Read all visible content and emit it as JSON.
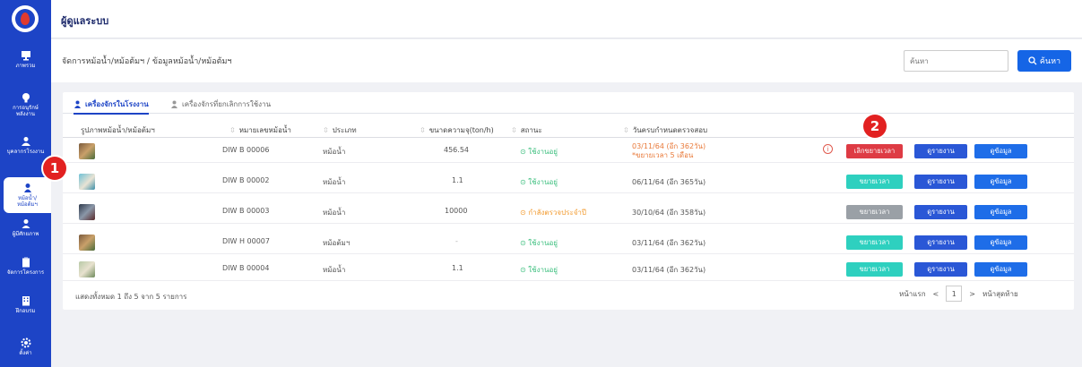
{
  "sidebar": {
    "items": [
      {
        "label": "ภาพรวม",
        "icon": "monitor-icon"
      },
      {
        "label": "การอนุรักษ์ พลังงาน",
        "icon": "bulb-icon"
      },
      {
        "label": "บุคลากรโรงงาน",
        "icon": "people-icon"
      },
      {
        "label": "หม้อน้ำ/ หม้อต้มฯ",
        "icon": "boiler-icon"
      },
      {
        "label": "ผู้มีศักยภาพ",
        "icon": "person-icon"
      },
      {
        "label": "จัดการโครงการ",
        "icon": "clipboard-icon"
      },
      {
        "label": "ฝึกอบรม",
        "icon": "building-icon"
      },
      {
        "label": "ตั้งค่า",
        "icon": "gear-icon"
      }
    ]
  },
  "header": {
    "title": "ผู้ดูแลระบบ"
  },
  "breadcrumb": "จัดการหม้อน้ำ/หม้อต้มฯ / ข้อมูลหม้อน้ำ/หม้อต้มฯ",
  "search": {
    "placeholder": "ค้นหา",
    "button_label": "ค้นหา"
  },
  "tabs": [
    {
      "label": "เครื่องจักรในโรงงาน",
      "active": true
    },
    {
      "label": "เครื่องจักรที่ยกเลิกการใช้งาน",
      "active": false
    }
  ],
  "table": {
    "columns": [
      "รูปภาพหม้อน้ำ/หม้อต้มฯ",
      "หมายเลขหม้อน้ำ",
      "ประเภท",
      "ขนาดความจุ(ton/h)",
      "สถานะ",
      "วันครบกำหนดตรวจสอบ"
    ],
    "rows": [
      {
        "id": "DIW B 00006",
        "type": "หม้อน้ำ",
        "capacity": "456.54",
        "status": "ใช้งานอยู่",
        "due": "03/11/64 (อีก 362วัน)",
        "due_note": "*ขยายเวลา 5 เดือน",
        "action": "เลิกขยายเวลา"
      },
      {
        "id": "DIW B 00002",
        "type": "หม้อน้ำ",
        "capacity": "1.1",
        "status": "ใช้งานอยู่",
        "due": "06/11/64 (อีก 365วัน)",
        "due_note": "",
        "action": "ขยายเวลา"
      },
      {
        "id": "DIW B 00003",
        "type": "หม้อน้ำ",
        "capacity": "10000",
        "status": "กำลังตรวจประจำปี",
        "due": "30/10/64 (อีก 358วัน)",
        "due_note": "",
        "action": "ขยายเวลา"
      },
      {
        "id": "DIW H 00007",
        "type": "หม้อต้มฯ",
        "capacity": "-",
        "status": "ใช้งานอยู่",
        "due": "03/11/64 (อีก 362วัน)",
        "due_note": "",
        "action": "ขยายเวลา"
      },
      {
        "id": "DIW B 00004",
        "type": "หม้อน้ำ",
        "capacity": "1.1",
        "status": "ใช้งานอยู่",
        "due": "03/11/64 (อีก 362วัน)",
        "due_note": "",
        "action": "ขยายเวลา"
      }
    ],
    "report_label": "ดูรายงาน",
    "info_label": "ดูข้อมูล"
  },
  "footer": {
    "summary": "แสดงทั้งหมด 1 ถึง 5 จาก 5 รายการ",
    "first": "หน้าแรก",
    "prev": "<",
    "page": "1",
    "next": ">",
    "last": "หน้าสุดท้าย"
  },
  "markers": [
    "1",
    "2"
  ],
  "colors": {
    "sidebar": "#1d44c6",
    "primary": "#1565e6",
    "teal": "#2ed0bf",
    "danger": "#de3b44",
    "ok": "#3cbf7e",
    "warn": "#f29a2e"
  }
}
